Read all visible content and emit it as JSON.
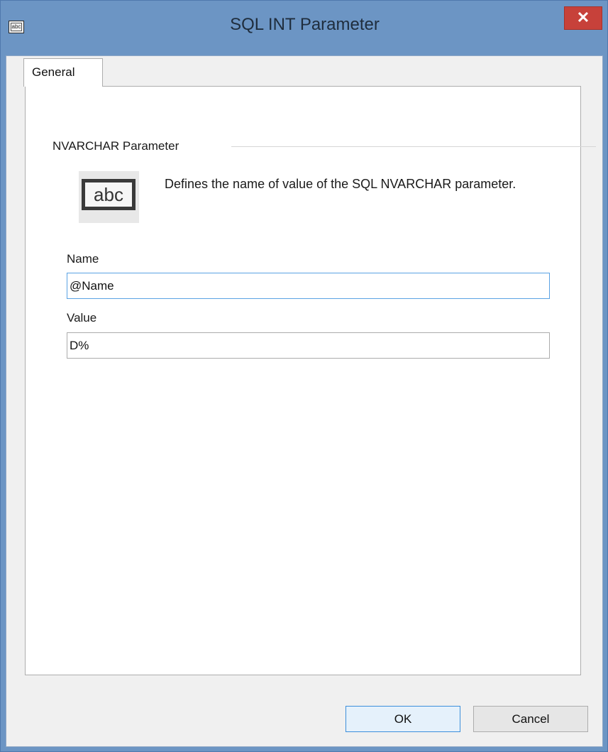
{
  "window": {
    "title": "SQL INT Parameter",
    "close_glyph": "✕",
    "app_icon_text": "abc"
  },
  "tabs": [
    {
      "label": "General",
      "selected": true
    }
  ],
  "group": {
    "title": "NVARCHAR Parameter",
    "icon_text": "abc",
    "description": "Defines the name of value of the SQL NVARCHAR parameter."
  },
  "fields": {
    "name": {
      "label": "Name",
      "value": "@Name"
    },
    "value": {
      "label": "Value",
      "value": "D%"
    }
  },
  "buttons": {
    "ok": "OK",
    "cancel": "Cancel"
  },
  "colors": {
    "title_bar": "#6c95c4",
    "close_button": "#c7413a",
    "focus_border": "#5aa2e4"
  }
}
